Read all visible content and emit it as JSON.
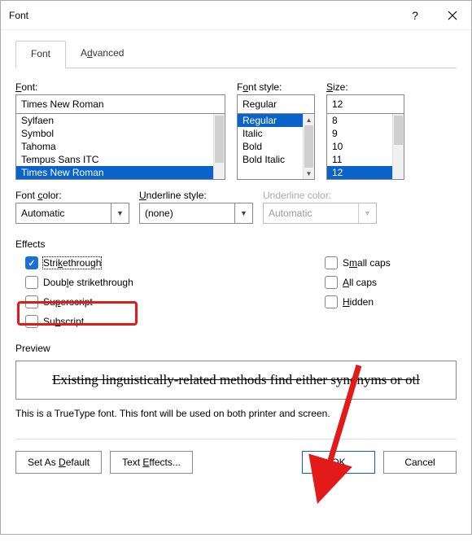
{
  "window": {
    "title": "Font"
  },
  "tabs": {
    "font": "Font",
    "advanced": "Advanced"
  },
  "font_section": {
    "label": "Font:",
    "value": "Times New Roman",
    "list": [
      "Sylfaen",
      "Symbol",
      "Tahoma",
      "Tempus Sans ITC",
      "Times New Roman"
    ],
    "selected_index": 4
  },
  "style_section": {
    "label": "Font style:",
    "value": "Regular",
    "list": [
      "Regular",
      "Italic",
      "Bold",
      "Bold Italic"
    ],
    "selected_index": 0
  },
  "size_section": {
    "label": "Size:",
    "value": "12",
    "list": [
      "8",
      "9",
      "10",
      "11",
      "12"
    ],
    "selected_index": 4
  },
  "color_row": {
    "font_color_label": "Font color:",
    "font_color_value": "Automatic",
    "underline_style_label": "Underline style:",
    "underline_style_value": "(none)",
    "underline_color_label": "Underline color:",
    "underline_color_value": "Automatic"
  },
  "effects": {
    "group_label": "Effects",
    "strikethrough": {
      "label": "Strikethrough",
      "checked": true
    },
    "double_strikethrough": {
      "label": "Double strikethrough",
      "checked": false
    },
    "superscript": {
      "label": "Superscript",
      "checked": false
    },
    "subscript": {
      "label": "Subscript",
      "checked": false
    },
    "small_caps": {
      "label": "Small caps",
      "checked": false
    },
    "all_caps": {
      "label": "All caps",
      "checked": false
    },
    "hidden": {
      "label": "Hidden",
      "checked": false
    }
  },
  "preview": {
    "label": "Preview",
    "text": "Existing linguistically-related methods find either synonyms or otl",
    "desc": "This is a TrueType font. This font will be used on both printer and screen."
  },
  "footer": {
    "set_default": "Set As Default",
    "text_effects": "Text Effects...",
    "ok": "OK",
    "cancel": "Cancel"
  },
  "chart_data": null
}
